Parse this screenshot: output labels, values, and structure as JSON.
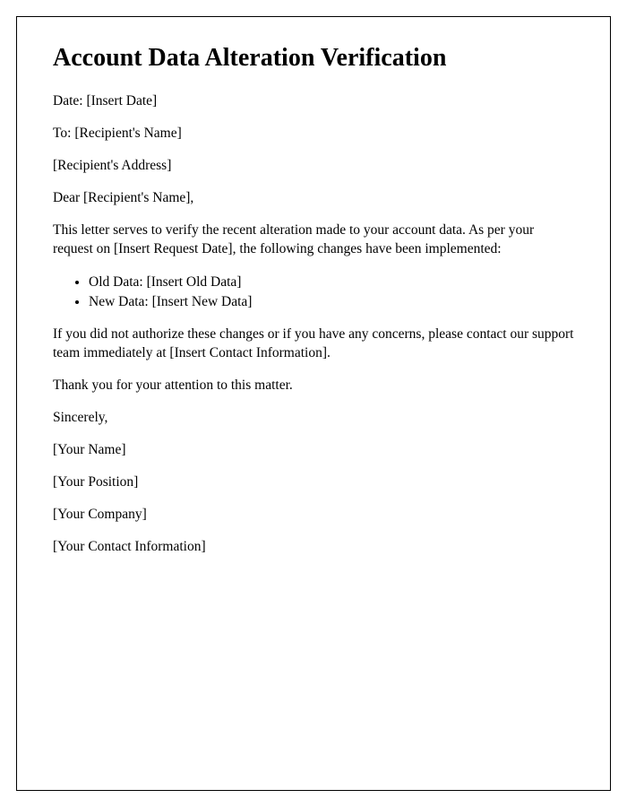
{
  "title": "Account Data Alteration Verification",
  "date_line": "Date: [Insert Date]",
  "to_line": "To: [Recipient's Name]",
  "address_line": "[Recipient's Address]",
  "salutation": "Dear [Recipient's Name],",
  "body_intro": "This letter serves to verify the recent alteration made to your account data. As per your request on [Insert Request Date], the following changes have been implemented:",
  "changes": {
    "old": "Old Data: [Insert Old Data]",
    "new": "New Data: [Insert New Data]"
  },
  "body_contact": "If you did not authorize these changes or if you have any concerns, please contact our support team immediately at [Insert Contact Information].",
  "body_thanks": "Thank you for your attention to this matter.",
  "closing": "Sincerely,",
  "signature": {
    "name": "[Your Name]",
    "position": "[Your Position]",
    "company": "[Your Company]",
    "contact": "[Your Contact Information]"
  }
}
